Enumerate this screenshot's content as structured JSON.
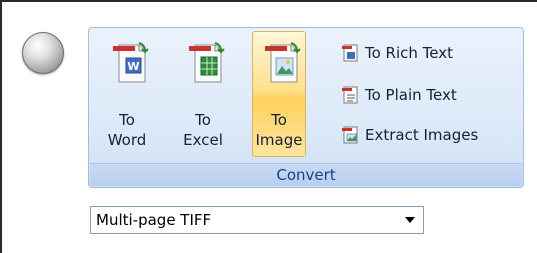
{
  "ribbon": {
    "group_label": "Convert",
    "big_buttons": [
      {
        "line1": "To",
        "line2": "Word",
        "icon": "word-document-icon"
      },
      {
        "line1": "To",
        "line2": "Excel",
        "icon": "excel-document-icon"
      },
      {
        "line1": "To",
        "line2": "Image",
        "icon": "image-document-icon",
        "state": "hovered"
      }
    ],
    "small_buttons": [
      {
        "label": "To Rich Text",
        "icon": "rich-text-icon"
      },
      {
        "label": "To Plain Text",
        "icon": "plain-text-icon"
      },
      {
        "label": "Extract Images",
        "icon": "extract-images-icon"
      }
    ]
  },
  "format_select": {
    "value": "Multi-page TIFF"
  },
  "colors": {
    "ribbon_border": "#9fbdde",
    "group_label_text": "#15428b",
    "hover_highlight": "#ffd15e"
  }
}
